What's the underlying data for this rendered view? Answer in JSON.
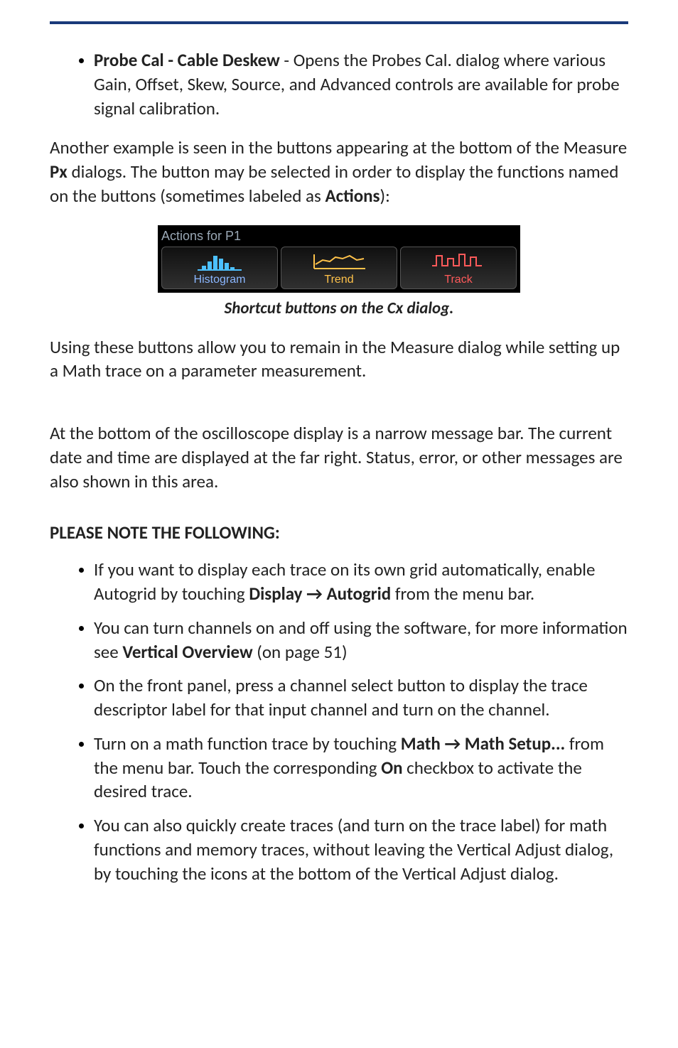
{
  "bullet_probe": {
    "lead_strong": "Probe Cal - Cable Deskew",
    "rest": " - Opens the Probes Cal. dialog where various Gain, Offset, Skew, Source, and Advanced controls are available for probe signal calibration."
  },
  "para_example_1": "Another example is seen in the buttons appearing at the bottom of the Measure ",
  "para_example_px": "Px",
  "para_example_2": " dialogs. The button may be selected in order to display the functions named on the buttons (sometimes labeled as ",
  "para_example_actions": "Actions",
  "para_example_3": "):",
  "figure": {
    "panel_title": "Actions for P1",
    "buttons": [
      {
        "label": "Histogram",
        "icon": "histogram-icon",
        "label_class": "lbl-hist"
      },
      {
        "label": "Trend",
        "icon": "trend-icon",
        "label_class": "lbl-trend"
      },
      {
        "label": "Track",
        "icon": "track-icon",
        "label_class": "lbl-track"
      }
    ],
    "caption": "Shortcut buttons on the Cx dialog."
  },
  "para_using": "Using these buttons allow you to remain in the Measure dialog while setting up a Math trace on a parameter measurement.",
  "para_message_bar": "At the bottom of the oscilloscope display is a narrow message bar. The current date and time are displayed at the far right. Status, error, or other messages are also shown in this area.",
  "note_heading": "PLEASE NOTE THE FOLLOWING",
  "note_heading_colon": ":",
  "notes": {
    "n1_a": "If you want to display each trace on its own grid automatically, enable Autogrid by touching ",
    "n1_b": "Display → Autogrid",
    "n1_c": " from the menu bar.",
    "n2_a": "You can turn channels on and off using the software, for more information see ",
    "n2_b": "Vertical Overview",
    "n2_c": " (on page 51)",
    "n3": "On the front panel, press a channel select button to display the trace descriptor label for that input channel and turn on the channel.",
    "n4_a": "Turn on a math function trace by touching ",
    "n4_b": "Math → Math Setup...",
    "n4_c": " from the menu bar. Touch the corresponding ",
    "n4_d": "On",
    "n4_e": " checkbox to activate the desired trace.",
    "n5": "You can also quickly create traces (and turn on the trace label) for math functions and memory traces, without leaving the Vertical Adjust dialog, by touching the icons at the bottom of the Vertical Adjust dialog."
  }
}
